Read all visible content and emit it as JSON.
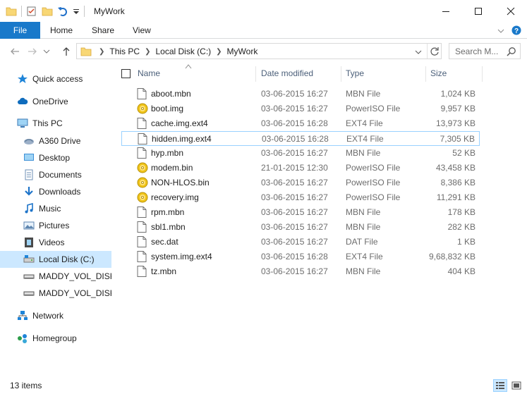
{
  "window": {
    "title": "MyWork"
  },
  "ribbon": {
    "tabs": [
      "File",
      "Home",
      "Share",
      "View"
    ]
  },
  "address": {
    "crumbs": [
      "This PC",
      "Local Disk (C:)",
      "MyWork"
    ]
  },
  "search": {
    "placeholder": "Search M..."
  },
  "nav": {
    "items": [
      {
        "label": "Quick access",
        "icon": "star-icon"
      },
      {
        "label": "OneDrive",
        "icon": "cloud-icon"
      },
      {
        "label": "This PC",
        "icon": "computer-icon"
      },
      {
        "label": "A360 Drive",
        "icon": "a360-drive-icon"
      },
      {
        "label": "Desktop",
        "icon": "desktop-folder-icon"
      },
      {
        "label": "Documents",
        "icon": "documents-folder-icon"
      },
      {
        "label": "Downloads",
        "icon": "downloads-folder-icon"
      },
      {
        "label": "Music",
        "icon": "music-folder-icon"
      },
      {
        "label": "Pictures",
        "icon": "pictures-folder-icon"
      },
      {
        "label": "Videos",
        "icon": "videos-folder-icon"
      },
      {
        "label": "Local Disk (C:)",
        "icon": "local-disk-icon"
      },
      {
        "label": "MADDY_VOL_DISK (",
        "icon": "drive-icon"
      },
      {
        "label": "MADDY_VOL_DISK (",
        "icon": "drive-icon"
      },
      {
        "label": "Network",
        "icon": "network-icon"
      },
      {
        "label": "Homegroup",
        "icon": "homegroup-icon"
      }
    ]
  },
  "columns": {
    "name": "Name",
    "date": "Date modified",
    "type": "Type",
    "size": "Size"
  },
  "files": [
    {
      "name": "aboot.mbn",
      "date": "03-06-2015 16:27",
      "type": "MBN File",
      "size": "1,024 KB",
      "icon": "file-icon"
    },
    {
      "name": "boot.img",
      "date": "03-06-2015 16:27",
      "type": "PowerISO File",
      "size": "9,957 KB",
      "icon": "disc-image-icon"
    },
    {
      "name": "cache.img.ext4",
      "date": "03-06-2015 16:28",
      "type": "EXT4 File",
      "size": "13,973 KB",
      "icon": "file-icon"
    },
    {
      "name": "hidden.img.ext4",
      "date": "03-06-2015 16:28",
      "type": "EXT4 File",
      "size": "7,305 KB",
      "icon": "file-icon"
    },
    {
      "name": "hyp.mbn",
      "date": "03-06-2015 16:27",
      "type": "MBN File",
      "size": "52 KB",
      "icon": "file-icon"
    },
    {
      "name": "modem.bin",
      "date": "21-01-2015 12:30",
      "type": "PowerISO File",
      "size": "43,458 KB",
      "icon": "disc-image-icon"
    },
    {
      "name": "NON-HLOS.bin",
      "date": "03-06-2015 16:27",
      "type": "PowerISO File",
      "size": "8,386 KB",
      "icon": "disc-image-icon"
    },
    {
      "name": "recovery.img",
      "date": "03-06-2015 16:27",
      "type": "PowerISO File",
      "size": "11,291 KB",
      "icon": "disc-image-icon"
    },
    {
      "name": "rpm.mbn",
      "date": "03-06-2015 16:27",
      "type": "MBN File",
      "size": "178 KB",
      "icon": "file-icon"
    },
    {
      "name": "sbl1.mbn",
      "date": "03-06-2015 16:27",
      "type": "MBN File",
      "size": "282 KB",
      "icon": "file-icon"
    },
    {
      "name": "sec.dat",
      "date": "03-06-2015 16:27",
      "type": "DAT File",
      "size": "1 KB",
      "icon": "file-icon"
    },
    {
      "name": "system.img.ext4",
      "date": "03-06-2015 16:28",
      "type": "EXT4 File",
      "size": "9,68,832 KB",
      "icon": "file-icon"
    },
    {
      "name": "tz.mbn",
      "date": "03-06-2015 16:27",
      "type": "MBN File",
      "size": "404 KB",
      "icon": "file-icon"
    }
  ],
  "status": {
    "count": "13 items"
  },
  "colors": {
    "accent": "#1979ca",
    "selection": "#cce8ff",
    "selection_border": "#99d1ff",
    "folder": "#f8d775"
  }
}
